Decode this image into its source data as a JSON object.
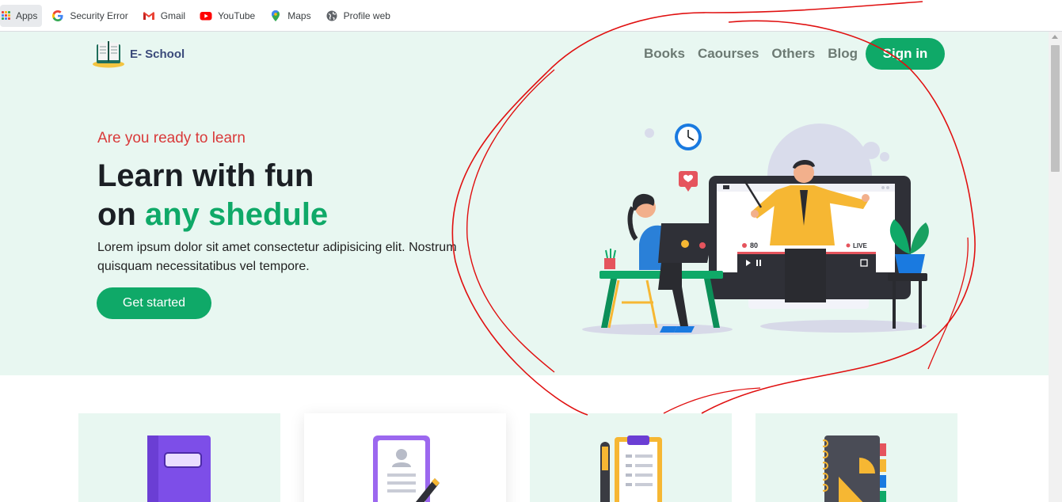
{
  "bookmarks": {
    "apps": "Apps",
    "items": [
      {
        "label": "Security Error",
        "icon": "google-icon"
      },
      {
        "label": "Gmail",
        "icon": "gmail-icon"
      },
      {
        "label": "YouTube",
        "icon": "youtube-icon"
      },
      {
        "label": "Maps",
        "icon": "maps-icon"
      },
      {
        "label": "Profile web",
        "icon": "globe-icon"
      }
    ]
  },
  "logo": {
    "text": "E- School",
    "icon": "book-logo-icon"
  },
  "nav": {
    "items": [
      "Books",
      "Caourses",
      "Others",
      "Blog"
    ],
    "signin": "Sign in"
  },
  "hero": {
    "kicker": "Are you ready to learn",
    "headline_line1": "Learn with fun",
    "headline_line2_prefix": "on ",
    "headline_line2_accent": "any shedule",
    "description": "Lorem ipsum dolor sit amet consectetur adipisicing elit. Nostrum quisquam necessitatibus vel tempore.",
    "cta": "Get started",
    "illustration": {
      "viewer_count": "80",
      "live_label": "LIVE"
    }
  },
  "cards": [
    {
      "icon": "purple-book-icon"
    },
    {
      "icon": "id-card-pen-icon"
    },
    {
      "icon": "clipboard-pen-icon"
    },
    {
      "icon": "spiral-notebook-icon"
    }
  ],
  "colors": {
    "brand_green": "#0fa968",
    "hero_bg": "#e8f7f1",
    "kicker_red": "#d93a3a",
    "annotation_red": "#e01010"
  }
}
